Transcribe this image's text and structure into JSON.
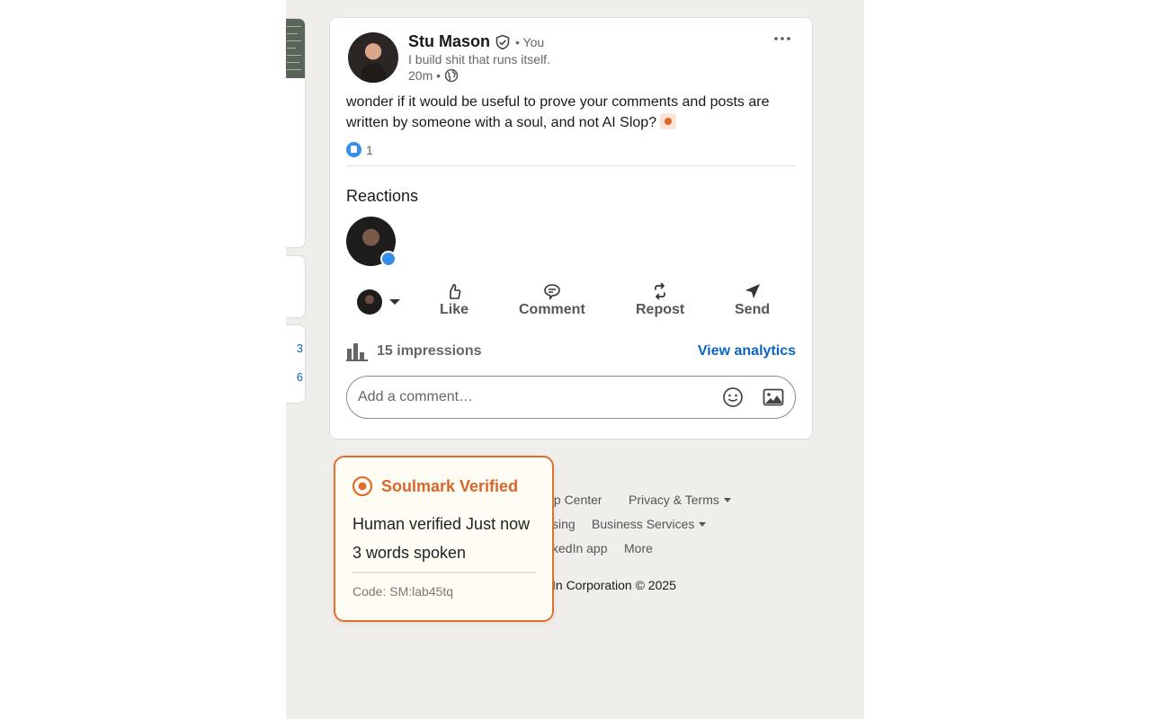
{
  "post": {
    "author_name": "Stu Mason",
    "you_label": "• You",
    "headline": "I build shit that runs itself.",
    "time": "20m •",
    "text": "wonder if it would be useful to prove your comments and posts are written by someone with a soul, and not AI Slop?",
    "reaction_count": "1",
    "reactions_title": "Reactions",
    "actions": {
      "like": "Like",
      "comment": "Comment",
      "repost": "Repost",
      "send": "Send"
    },
    "impressions": "15 impressions",
    "view_analytics": "View analytics",
    "comment_placeholder": "Add a comment…"
  },
  "left_partial": {
    "text1": "3",
    "text2": "6"
  },
  "footer": {
    "help_center": "elp Center",
    "privacy_terms": "Privacy & Terms",
    "advertising": "sing",
    "business_services": "Business Services",
    "app": "kedIn app",
    "more": "More",
    "copyright": "In Corporation © 2025"
  },
  "soulmark": {
    "title": "Soulmark Verified",
    "line1": "Human verified Just now",
    "line2": "3 words spoken",
    "code": "Code: SM:lab45tq",
    "accent_color": "#e06f2f"
  }
}
